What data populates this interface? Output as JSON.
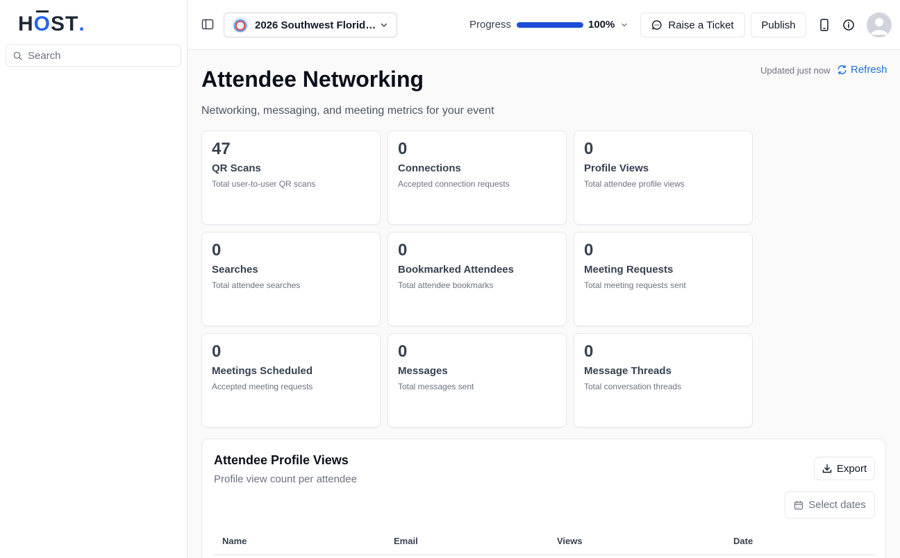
{
  "brand": {
    "logo_h": "H",
    "logo_o": "O",
    "logo_st": "ST",
    "logo_dot": "."
  },
  "sidebar": {
    "search_placeholder": "Search"
  },
  "header": {
    "event_name": "2026 Southwest Florida...",
    "progress_label": "Progress",
    "progress_value": 100,
    "progress_text": "100%",
    "raise_ticket_label": "Raise a Ticket",
    "publish_label": "Publish"
  },
  "page": {
    "title": "Attendee Networking",
    "subtitle": "Networking, messaging, and meeting metrics for your event",
    "updated_text": "Updated just now",
    "refresh_label": "Refresh"
  },
  "metrics": [
    {
      "value": "47",
      "label": "QR Scans",
      "desc": "Total user-to-user QR scans"
    },
    {
      "value": "0",
      "label": "Connections",
      "desc": "Accepted connection requests"
    },
    {
      "value": "0",
      "label": "Profile Views",
      "desc": "Total attendee profile views"
    },
    {
      "value": "0",
      "label": "Searches",
      "desc": "Total attendee searches"
    },
    {
      "value": "0",
      "label": "Bookmarked Attendees",
      "desc": "Total attendee bookmarks"
    },
    {
      "value": "0",
      "label": "Meeting Requests",
      "desc": "Total meeting requests sent"
    },
    {
      "value": "0",
      "label": "Meetings Scheduled",
      "desc": "Accepted meeting requests"
    },
    {
      "value": "0",
      "label": "Messages",
      "desc": "Total messages sent"
    },
    {
      "value": "0",
      "label": "Message Threads",
      "desc": "Total conversation threads"
    }
  ],
  "profile_views": {
    "title": "Attendee Profile Views",
    "subtitle": "Profile view count per attendee",
    "export_label": "Export",
    "date_placeholder": "Select dates",
    "columns": [
      "Name",
      "Email",
      "Views",
      "Date"
    ]
  },
  "colors": {
    "accent": "#2563eb",
    "progress_fill": "#1d4ed8",
    "link": "#1d6fe0"
  }
}
